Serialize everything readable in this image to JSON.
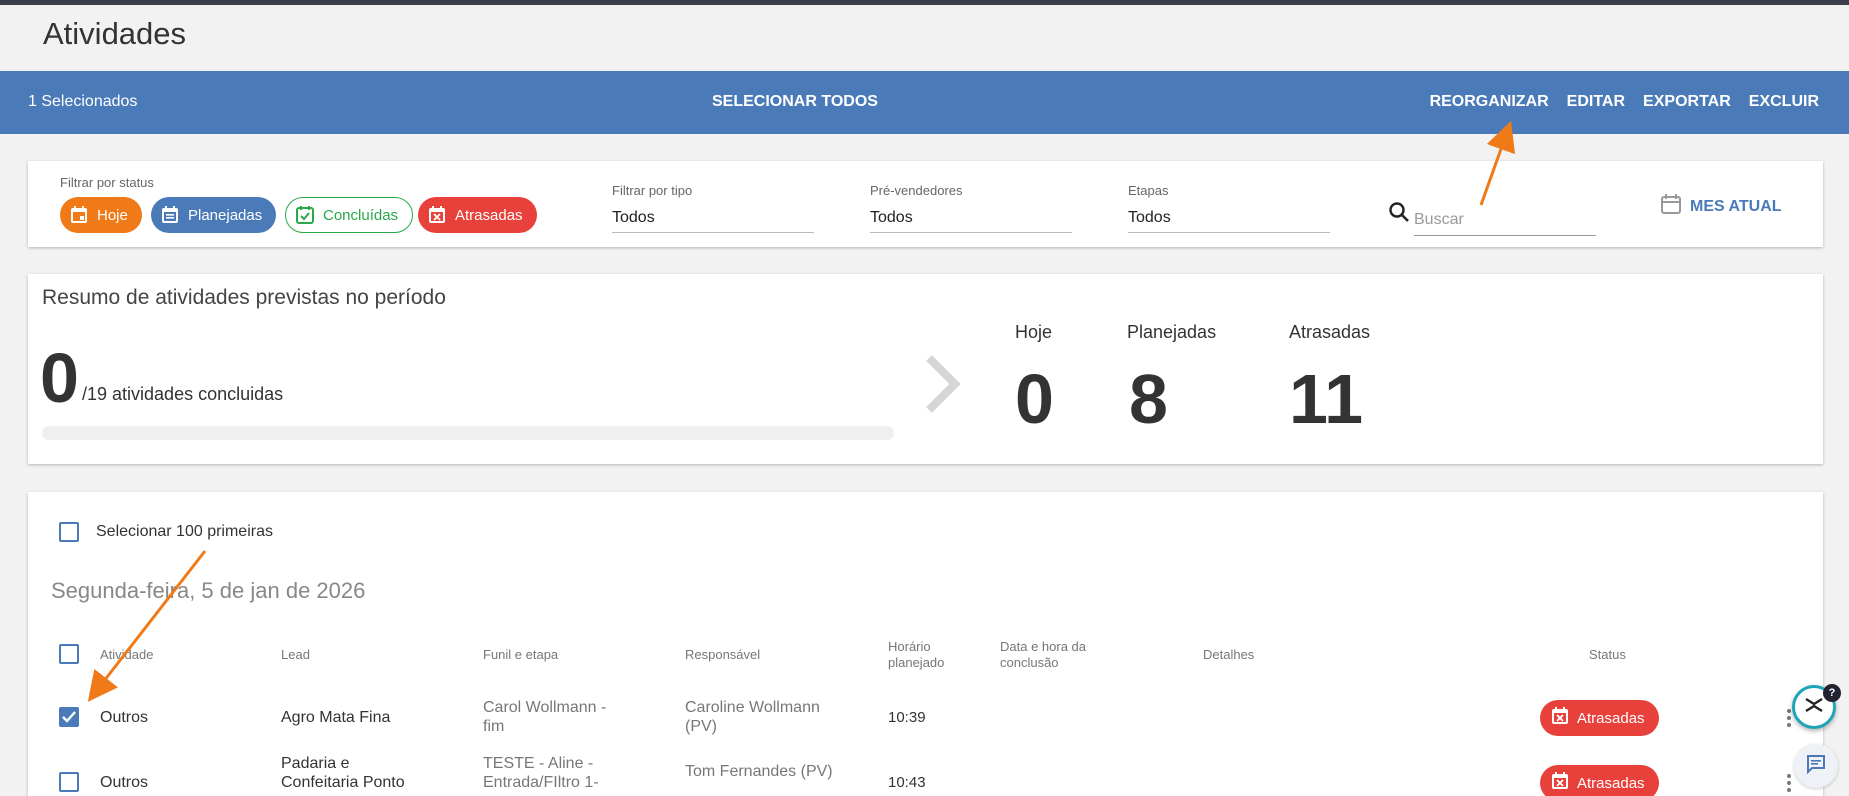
{
  "page": {
    "title": "Atividades"
  },
  "actionbar": {
    "selected_count": "1 Selecionados",
    "select_all": "SELECIONAR TODOS",
    "reorganize": "REORGANIZAR",
    "edit": "EDITAR",
    "export": "EXPORTAR",
    "delete": "EXCLUIR"
  },
  "filters": {
    "status_label": "Filtrar por status",
    "chips": {
      "hoje": "Hoje",
      "planejadas": "Planejadas",
      "concluidas": "Concluídas",
      "atrasadas": "Atrasadas"
    },
    "type": {
      "label": "Filtrar por tipo",
      "value": "Todos"
    },
    "presellers": {
      "label": "Pré-vendedores",
      "value": "Todos"
    },
    "stages": {
      "label": "Etapas",
      "value": "Todos"
    },
    "search": {
      "placeholder": "Buscar",
      "value": ""
    },
    "month": "MES ATUAL"
  },
  "summary": {
    "title": "Resumo de atividades previstas no período",
    "completed": "0",
    "total_text": "/19 atividades concluidas",
    "progress": 0,
    "stats": {
      "hoje": {
        "label": "Hoje",
        "value": "0"
      },
      "planejadas": {
        "label": "Planejadas",
        "value": "8"
      },
      "atrasadas": {
        "label": "Atrasadas",
        "value": "11"
      }
    }
  },
  "list": {
    "select_first_label": "Selecionar 100 primeiras",
    "day_title": "Segunda-feira, 5 de jan de 2026",
    "columns": {
      "activity": "Atividade",
      "lead": "Lead",
      "funnel": "Funil e etapa",
      "owner": "Responsável",
      "planned_time": "Horário planejado",
      "completion": "Data e hora da conclusão",
      "details": "Detalhes",
      "status": "Status"
    },
    "rows": [
      {
        "checked": true,
        "activity": "Outros",
        "lead": "Agro Mata Fina",
        "funnel": "Carol Wollmann - fim",
        "owner": "Caroline Wollmann (PV)",
        "time": "10:39",
        "status": "Atrasadas"
      },
      {
        "checked": false,
        "activity": "Outros",
        "lead": "Padaria e Confeitaria Ponto",
        "funnel": "TESTE - Aline - Entrada/FIltro 1-",
        "owner": "Tom Fernandes (PV)",
        "time": "10:43",
        "status": "Atrasadas"
      }
    ]
  },
  "colors": {
    "primary": "#4a7bb8",
    "orange": "#f07a18",
    "green": "#29a84a",
    "red": "#e8403a",
    "annotation": "#f07a18"
  }
}
